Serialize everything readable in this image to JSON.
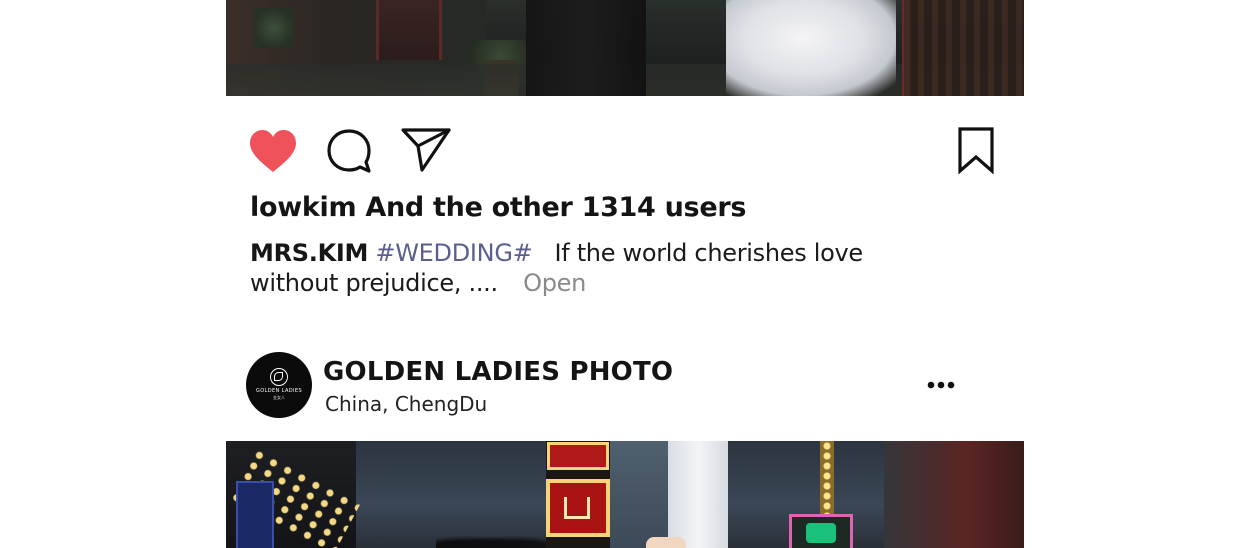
{
  "previous_post": {
    "photo_alt": "wedding couple photo",
    "actions": {
      "like_icon": "heart-filled-icon",
      "comment_icon": "comment-bubble-icon",
      "share_icon": "paper-plane-icon",
      "save_icon": "bookmark-icon"
    },
    "likes_text": "lowkim And the other 1314 users",
    "caption": {
      "author": "MRS.KIM",
      "hashtag": "#WEDDING#",
      "text": "If the world cherishes love without prejudice, ....",
      "more_label": "Open"
    }
  },
  "next_post": {
    "header": {
      "avatar_brand": "GOLDEN LADIES",
      "avatar_sub": "金女人",
      "account_name": "GOLDEN LADIES PHOTO",
      "location": "China,  ChengDu",
      "more_icon": "more-dots-icon"
    },
    "photo_alt": "wedding couple neon street photo"
  },
  "colors": {
    "like_red": "#f0525b",
    "hashtag": "#5b5f8e",
    "muted": "#8a8a8a",
    "text": "#141414"
  }
}
